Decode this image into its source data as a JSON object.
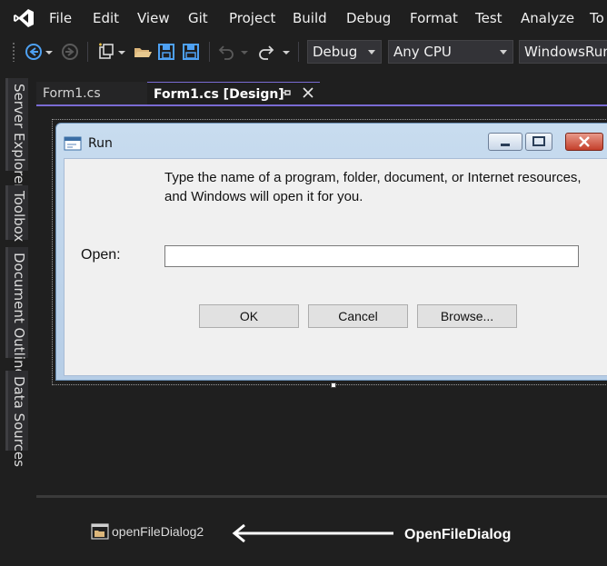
{
  "menu": {
    "items": [
      "File",
      "Edit",
      "View",
      "Git",
      "Project",
      "Build",
      "Debug",
      "Format",
      "Test",
      "Analyze",
      "To"
    ]
  },
  "toolbar": {
    "config_value": "Debug",
    "platform_value": "Any CPU",
    "startup_value": "WindowsRunU"
  },
  "side_tabs": [
    "Server Explorer",
    "Toolbox",
    "Document Outline",
    "Data Sources"
  ],
  "doc_tabs": {
    "inactive": "Form1.cs",
    "active": "Form1.cs [Design]"
  },
  "form": {
    "title": "Run",
    "prompt": "Type the name of a program, folder, document, or Internet resources, and Windows will open it for you.",
    "open_label": "Open:",
    "open_value": "",
    "buttons": {
      "ok": "OK",
      "cancel": "Cancel",
      "browse": "Browse..."
    }
  },
  "component_tray": {
    "component_name": "openFileDialog2"
  },
  "annotation": {
    "label": "OpenFileDialog"
  },
  "colors": {
    "accent": "#7a6bd3",
    "ide_background": "#1f1f1f",
    "form_client": "#f0f0f0"
  }
}
